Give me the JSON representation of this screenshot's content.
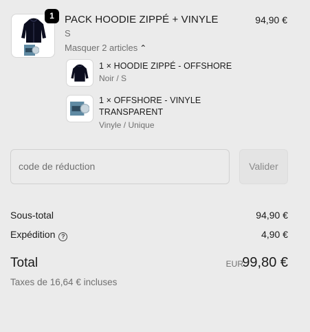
{
  "product": {
    "quantity": "1",
    "title": "PACK HOODIE ZIPPÉ + VINYLE",
    "price": "94,90 €",
    "variant": "S",
    "toggle_label": "Masquer 2 articles"
  },
  "bundle_items": [
    {
      "title_line1": "1 × HOODIE ZIPPÉ - OFFSHORE",
      "title_line2": "",
      "variant": "Noir / S"
    },
    {
      "title_line1": "1 × OFFSHORE - VINYLE",
      "title_line2": "TRANSPARENT",
      "variant": "Vinyle / Unique"
    }
  ],
  "discount": {
    "placeholder": "code de réduction",
    "apply_label": "Valider"
  },
  "summary": {
    "subtotal_label": "Sous-total",
    "subtotal_value": "94,90 €",
    "shipping_label": "Expédition",
    "shipping_value": "4,90 €",
    "total_label": "Total",
    "currency": "EUR",
    "total_value": "99,80 €",
    "taxes_note": "Taxes de 16,64 € incluses"
  },
  "colors": {
    "background": "#ebebeb",
    "text": "#1a1a1a",
    "muted": "#707070",
    "badge": "#000000"
  },
  "icons": {
    "toggle": "chevron-up-icon",
    "shipping_help": "question-circle-icon"
  }
}
